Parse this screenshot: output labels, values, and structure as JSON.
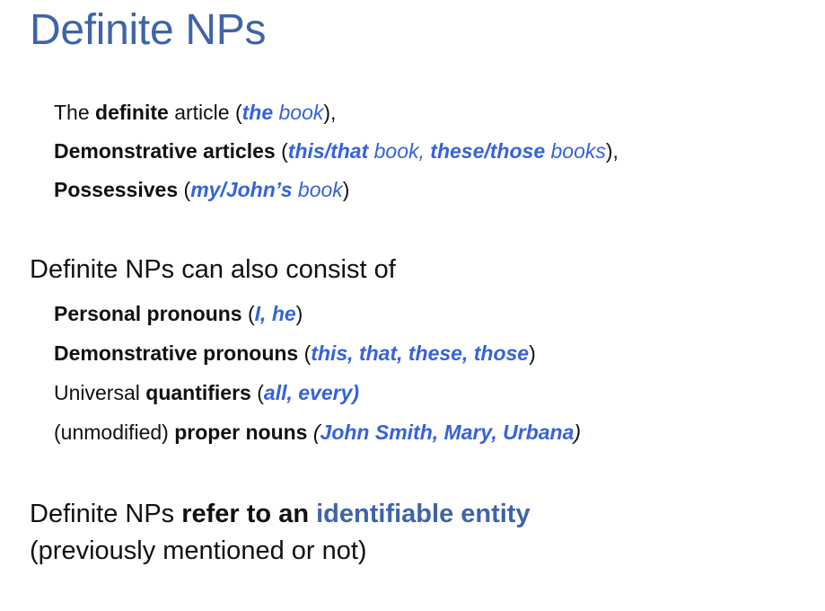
{
  "slide": {
    "title": "Definite NPs",
    "block1": {
      "line1": {
        "t1": "The ",
        "t2": "definite",
        "t3": " article (",
        "e1": "the",
        "e2": " book",
        "t4": "),"
      },
      "line2": {
        "t1": "Demonstrative articles",
        "t2": " (",
        "e1": "this/that",
        "e2": " book, ",
        "e3": "these/those",
        "e4": " books",
        "t3": "),"
      },
      "line3": {
        "t1": "Possessives",
        "t2": " (",
        "e1": "my/John’s",
        "e2": " book",
        "t3": ")"
      }
    },
    "block2": {
      "heading": "Definite NPs can also consist of",
      "line1": {
        "t1": "Personal pronouns",
        "t2": " (",
        "e1": "I, he",
        "t3": ")"
      },
      "line2": {
        "t1": "Demonstrative pronouns",
        "t2": " (",
        "e1": "this, that, these, those",
        "t3": ")"
      },
      "line3": {
        "t1": "Universal ",
        "t2": "quantifiers",
        "t3": " (",
        "e1": "all, every)"
      },
      "line4": {
        "t1": "(unmodified) ",
        "t2": "proper nouns",
        "t3": " ",
        "t4": "(",
        "e1": "John Smith, Mary, Urbana",
        "t5": ")"
      }
    },
    "block3": {
      "line1": {
        "t1": "Definite NPs ",
        "t2": "refer to an",
        "t3": " ",
        "t4": "identifiable entity"
      },
      "line2": "(previously mentioned or not)"
    }
  }
}
